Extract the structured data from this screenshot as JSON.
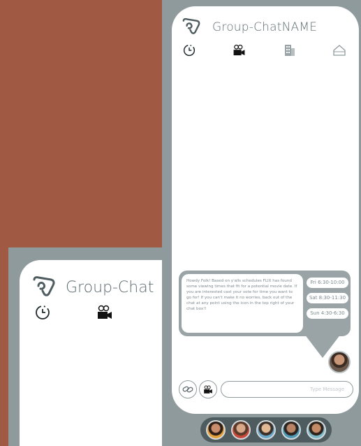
{
  "chat": {
    "title": "Group-ChatNAME",
    "nav": [
      {
        "name": "history",
        "icon": "clock-icon"
      },
      {
        "name": "movie",
        "icon": "movie-camera-icon"
      },
      {
        "name": "schedule",
        "icon": "building-icon"
      },
      {
        "name": "home",
        "icon": "home-icon"
      }
    ],
    "message": "Howdy Folk! Based on y'alls schedules FLIX has found some viewing times that fit for a potential movie date. If you are interested cast your vote for time you want to go for! If you can't make it no worries, back out of the chat at any point using the icon in the top right of your chat box!!",
    "times": [
      "Fri 6:30-10:00",
      "Sat 8:30-11:30",
      "Sun 4:30-6:30"
    ],
    "composer": {
      "placeholder": "Type Message"
    },
    "members_count": 5
  },
  "back_screen": {
    "title": "Group-Chat"
  },
  "colors": {
    "background": "#a05a44",
    "bezel": "#8f9a9d",
    "bubble": "#9aa4a7",
    "text": "#5d6c70",
    "member_bar": "#4e5b5f"
  }
}
